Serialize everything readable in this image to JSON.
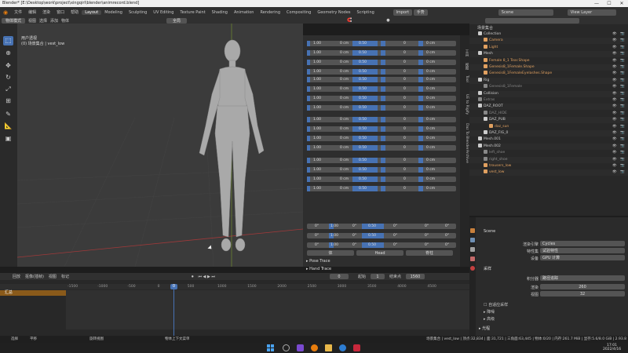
{
  "window": {
    "title": "Blender* [E:\\Desktop\\work\\project\\xingqirl\\blender\\animrecord.blend]",
    "min": "—",
    "max": "☐",
    "close": "✕"
  },
  "menu": {
    "items": [
      "文件",
      "编辑",
      "渲染",
      "窗口",
      "帮助"
    ],
    "workspaces": [
      "Layout",
      "Modeling",
      "Sculpting",
      "UV Editing",
      "Texture Paint",
      "Shading",
      "Animation",
      "Rendering",
      "Compositing",
      "Geometry Nodes",
      "Scripting"
    ],
    "active_workspace": "Layout",
    "scene": "Scene",
    "view_layer": "View Layer",
    "import_btn": "Import",
    "hand_btn": "手势"
  },
  "viewport_header": {
    "mode": "物体模式",
    "menus": [
      "视图",
      "选择",
      "添加",
      "物体"
    ],
    "pivot": "全局"
  },
  "viewport": {
    "overlay_line1": "用户透视",
    "overlay_line2": "(0) 场景集合 | vest_low"
  },
  "panel": {
    "rows": [
      [
        "1.00",
        "0 cm",
        "0.50",
        "0",
        "0 cm"
      ],
      [
        "1.00",
        "0 cm",
        "0.50",
        "0",
        "0 cm"
      ],
      [
        "1.00",
        "0 cm",
        "0.50",
        "0",
        "0 cm"
      ],
      [
        "1.00",
        "0 cm",
        "0.50",
        "0",
        "0 cm"
      ],
      [
        "1.00",
        "0 cm",
        "0.50",
        "0",
        "0 cm"
      ],
      [
        "1.00",
        "0 cm",
        "0.50",
        "0",
        "0 cm"
      ],
      [
        "1.00",
        "0 cm",
        "0.50",
        "0",
        "0 cm"
      ],
      [
        "1.00",
        "0 cm",
        "0.50",
        "0",
        "0 cm"
      ],
      [
        "1.00",
        "0 cm",
        "0.50",
        "0",
        "0 cm"
      ],
      [
        "1.00",
        "0 cm",
        "0.50",
        "0",
        "0 cm"
      ],
      [
        "1.00",
        "0 cm",
        "0.50",
        "0",
        "0 cm"
      ],
      [
        "1.00",
        "0 cm",
        "0.50",
        "0",
        "0 cm"
      ],
      [
        "1.00",
        "0 cm",
        "0.50",
        "0",
        "0 cm"
      ],
      [
        "1.00",
        "0 cm",
        "0.50",
        "0",
        "0 cm"
      ],
      [
        "1.00",
        "0 cm",
        "0.50",
        "0",
        "0 cm"
      ],
      [
        "1.00",
        "0 cm",
        "0.50",
        "0",
        "0 cm"
      ]
    ],
    "angle_rows": [
      [
        "0°",
        "1.00",
        "0°",
        "0.50",
        "0°",
        "0°",
        "0°"
      ],
      [
        "0°",
        "1.00",
        "0°",
        "0.50",
        "0°",
        "0°",
        "0°"
      ],
      [
        "0°",
        "1.00",
        "0°",
        "0.50",
        "0°",
        "0°",
        "0°"
      ]
    ],
    "buttons": [
      "体",
      "Head",
      "脊柱"
    ],
    "sections": [
      "Pose Trace",
      "Hand Trace"
    ]
  },
  "sidetabs": [
    "工具",
    "视图",
    "Tool",
    "UE to Rigify",
    "Daz To Blender",
    "Archive"
  ],
  "outliner": {
    "search_placeholder": "",
    "title": "场景集合",
    "rows": [
      {
        "label": "Collection",
        "indent": 1,
        "color": "#cccccc"
      },
      {
        "label": "Camera",
        "indent": 2,
        "color": "#e0a060"
      },
      {
        "label": "Light",
        "indent": 2,
        "color": "#e0a060"
      },
      {
        "label": "Mesh",
        "indent": 1,
        "color": "#cccccc"
      },
      {
        "label": "Female 8_1 Tear.Shape",
        "indent": 2,
        "color": "#e0a060"
      },
      {
        "label": "Genesis8_1Female.Shape",
        "indent": 2,
        "color": "#e0a060"
      },
      {
        "label": "Genesis8_1FemaleEyelashes.Shape",
        "indent": 2,
        "color": "#e0a060"
      },
      {
        "label": "Rig",
        "indent": 1,
        "color": "#cccccc"
      },
      {
        "label": "Genesis8_1Female",
        "indent": 2,
        "color": "#888888"
      },
      {
        "label": "Collision",
        "indent": 1,
        "color": "#cccccc"
      },
      {
        "label": "Extras",
        "indent": 1,
        "color": "#888888"
      },
      {
        "label": "DAZ_ROOT",
        "indent": 1,
        "color": "#cccccc"
      },
      {
        "label": "DAZ_HIDE",
        "indent": 2,
        "color": "#888888"
      },
      {
        "label": "DAZ_PUB",
        "indent": 2,
        "color": "#cccccc"
      },
      {
        "label": "daz_sun",
        "indent": 3,
        "color": "#e0a060"
      },
      {
        "label": "DAZ_FIG_0",
        "indent": 2,
        "color": "#cccccc"
      },
      {
        "label": "Mesh.001",
        "indent": 1,
        "color": "#cccccc"
      },
      {
        "label": "Mesh.002",
        "indent": 1,
        "color": "#cccccc"
      },
      {
        "label": "left_shoe",
        "indent": 2,
        "color": "#888888"
      },
      {
        "label": "right_shoe",
        "indent": 2,
        "color": "#888888"
      },
      {
        "label": "trousers_low",
        "indent": 2,
        "color": "#e0a060"
      },
      {
        "label": "vest_low",
        "indent": 2,
        "color": "#e0a060"
      }
    ]
  },
  "properties": {
    "scene": "Scene",
    "render_engine_label": "渲染引擎",
    "render_engine": "Cycles",
    "feature_label": "特性集",
    "feature": "试验特性",
    "device_label": "设备",
    "device": "GPU 计算",
    "sampling": "采样",
    "integrator_label": "积分器",
    "integrator": "路径追踪",
    "render_label": "渲染",
    "render_val": "260",
    "viewport_label": "视图",
    "viewport_val": "32",
    "adaptive": "自适应采样",
    "denoise": "降噪",
    "advanced": "高级",
    "light_paths": "光程"
  },
  "timeline": {
    "menus": [
      "回放",
      "抠像(插帧)",
      "视图",
      "标记"
    ],
    "current_frame": "0",
    "start_label": "起始",
    "start": "1",
    "end_label": "结束点",
    "end": "1560",
    "ruler": [
      "-1500",
      "-1000",
      "-500",
      "0",
      "500",
      "1000",
      "1500",
      "2000",
      "2500",
      "3000",
      "3500",
      "4000",
      "4500"
    ],
    "track": "汇总"
  },
  "status": {
    "select": "选择",
    "move": "平移",
    "rotate": "旋转视图",
    "context": "物体上下文菜单",
    "info": "场景集合 | vest_low | 顶点:32,834 | 面:31,721 | 三角面:63,445 | 物体:0/20 | 内存:261.7 MiB | 显存:5.6/8.0 GiB | 2.93.8"
  },
  "clock": {
    "time": "17:01",
    "date": "2022/4/16"
  }
}
